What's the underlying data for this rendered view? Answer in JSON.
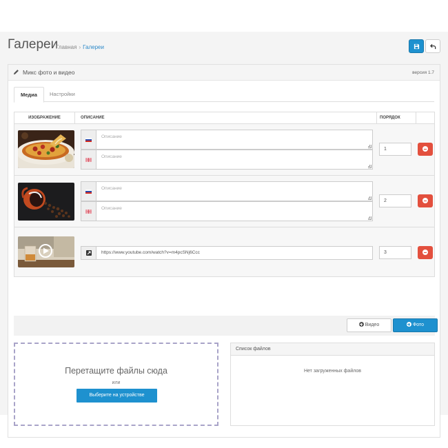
{
  "header": {
    "title": "Галереи",
    "breadcrumb": {
      "home": "Главная",
      "separator": "›",
      "current": "Галереи"
    },
    "save_icon": "floppy-disk-icon",
    "back_icon": "undo-arrow-icon"
  },
  "panel": {
    "title": "Микс фото и видео",
    "version": "версия 1.7",
    "icon": "pencil-icon"
  },
  "tabs": [
    {
      "label": "Медиа",
      "active": true
    },
    {
      "label": "Настройки",
      "active": false
    }
  ],
  "table": {
    "headers": {
      "image": "ИЗОБРАЖЕНИЕ",
      "description": "ОПИСАНИЕ",
      "order": "ПОРЯДОК"
    },
    "rows": [
      {
        "thumbnail": "pizza-photo",
        "fields": [
          {
            "flag": "ru",
            "placeholder": "Описание"
          },
          {
            "flag": "en",
            "placeholder": "Описание"
          }
        ],
        "order": "1"
      },
      {
        "thumbnail": "coffee-cup-photo",
        "fields": [
          {
            "flag": "ru",
            "placeholder": "Описание"
          },
          {
            "flag": "en",
            "placeholder": "Описание"
          }
        ],
        "order": "2"
      },
      {
        "thumbnail": "video-thumbnail",
        "url": "https://www.youtube.com/watch?v=m4pcSNj6Ccc",
        "order": "3"
      }
    ]
  },
  "actions": {
    "video_label": "Видео",
    "photo_label": "Фото"
  },
  "dropzone": {
    "title": "Перетащите файлы сюда",
    "or": "или",
    "button_label": "Выберите на устройстве"
  },
  "file_list": {
    "heading": "Список файлов",
    "empty": "Нет загруженных файлов"
  },
  "colors": {
    "primary": "#1e91cf",
    "danger": "#e3503e",
    "dashed_border": "#a8a3c8"
  }
}
